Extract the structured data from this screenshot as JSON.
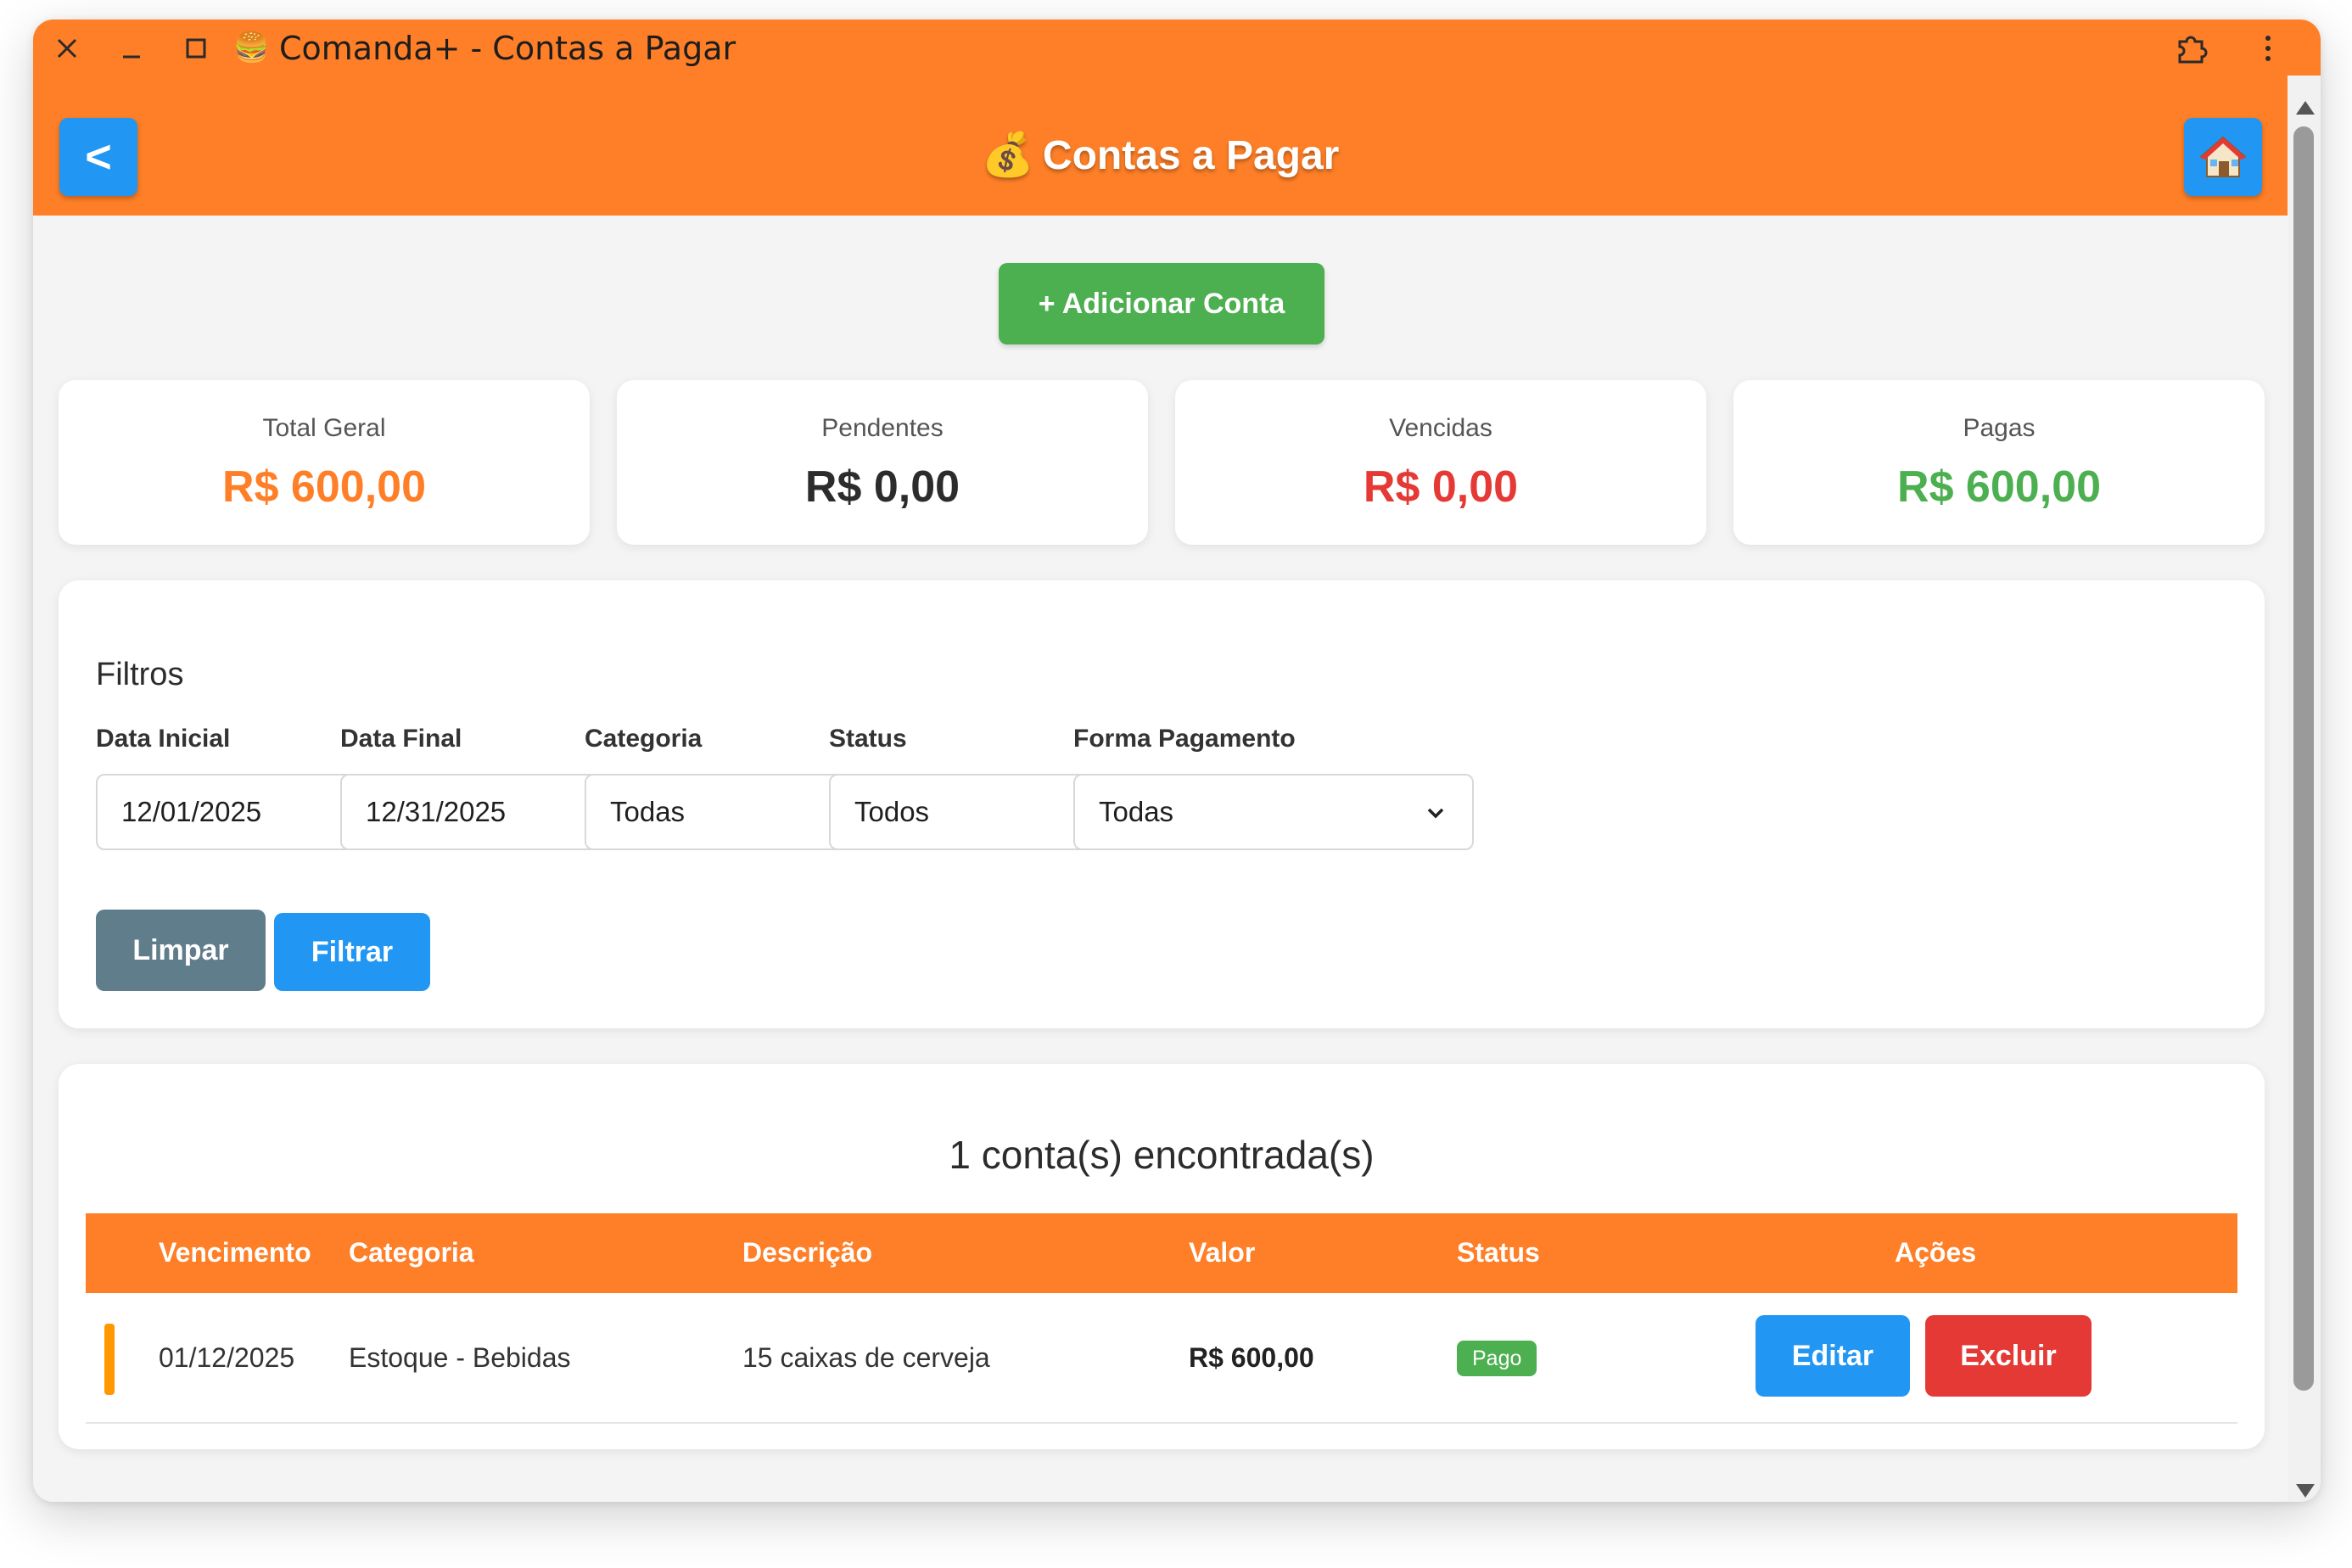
{
  "window": {
    "title": "Comanda+ - Contas a Pagar",
    "logo_glyph": "🍔"
  },
  "header": {
    "back_label": "<",
    "title_icon": "💰",
    "title": "Contas a Pagar",
    "home_icon": "house-icon"
  },
  "actions": {
    "add_label": "+ Adicionar Conta"
  },
  "summary": [
    {
      "label": "Total Geral",
      "value": "R$ 600,00",
      "color": "#fe7f27"
    },
    {
      "label": "Pendentes",
      "value": "R$ 0,00",
      "color": "#2c2c2c"
    },
    {
      "label": "Vencidas",
      "value": "R$ 0,00",
      "color": "#e53935"
    },
    {
      "label": "Pagas",
      "value": "R$ 600,00",
      "color": "#4caf50"
    }
  ],
  "filters": {
    "title": "Filtros",
    "fields": [
      {
        "label": "Data Inicial",
        "value": "12/01/2025",
        "type": "date"
      },
      {
        "label": "Data Final",
        "value": "12/31/2025",
        "type": "date"
      },
      {
        "label": "Categoria",
        "value": "Todas",
        "type": "select"
      },
      {
        "label": "Status",
        "value": "Todos",
        "type": "select"
      },
      {
        "label": "Forma Pagamento",
        "value": "Todas",
        "type": "select"
      }
    ],
    "clear_label": "Limpar",
    "filter_label": "Filtrar"
  },
  "results": {
    "count_text": "1 conta(s) encontrada(s)",
    "columns": [
      "Vencimento",
      "Categoria",
      "Descrição",
      "Valor",
      "Status",
      "Ações"
    ],
    "rows": [
      {
        "vencimento": "01/12/2025",
        "categoria": "Estoque - Bebidas",
        "descricao": "15 caixas de cerveja",
        "valor": "R$ 600,00",
        "status": "Pago",
        "edit_label": "Editar",
        "delete_label": "Excluir"
      }
    ]
  },
  "colors": {
    "brand_orange": "#fe7f27",
    "primary_blue": "#2196f3",
    "success_green": "#4caf50",
    "danger_red": "#e53935",
    "neutral_gray": "#607d8b"
  }
}
